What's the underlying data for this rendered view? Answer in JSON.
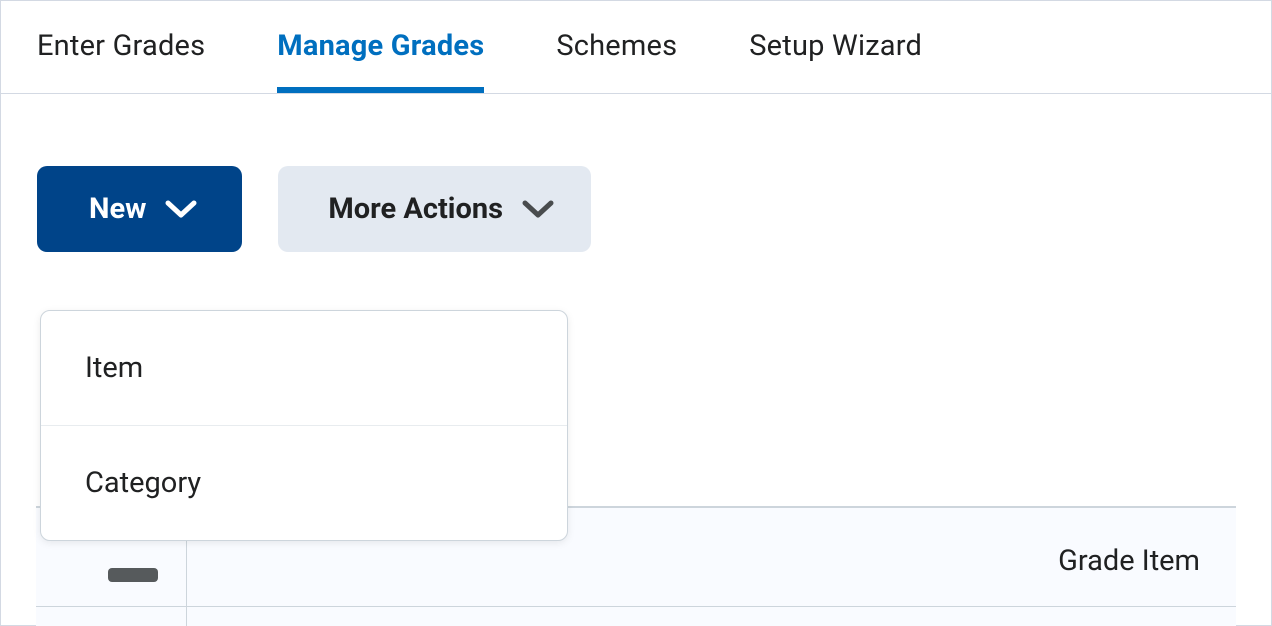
{
  "tabs": {
    "enter_grades": "Enter Grades",
    "manage_grades": "Manage Grades",
    "schemes": "Schemes",
    "setup_wizard": "Setup Wizard"
  },
  "toolbar": {
    "new_label": "New",
    "more_actions_label": "More Actions"
  },
  "dropdown": {
    "item": "Item",
    "category": "Category"
  },
  "table": {
    "column_grade_item": "Grade Item"
  },
  "colors": {
    "primary": "#006fbf",
    "primary_dark": "#004489",
    "secondary_bg": "#e3e9f1",
    "border": "#cdd5dc"
  }
}
